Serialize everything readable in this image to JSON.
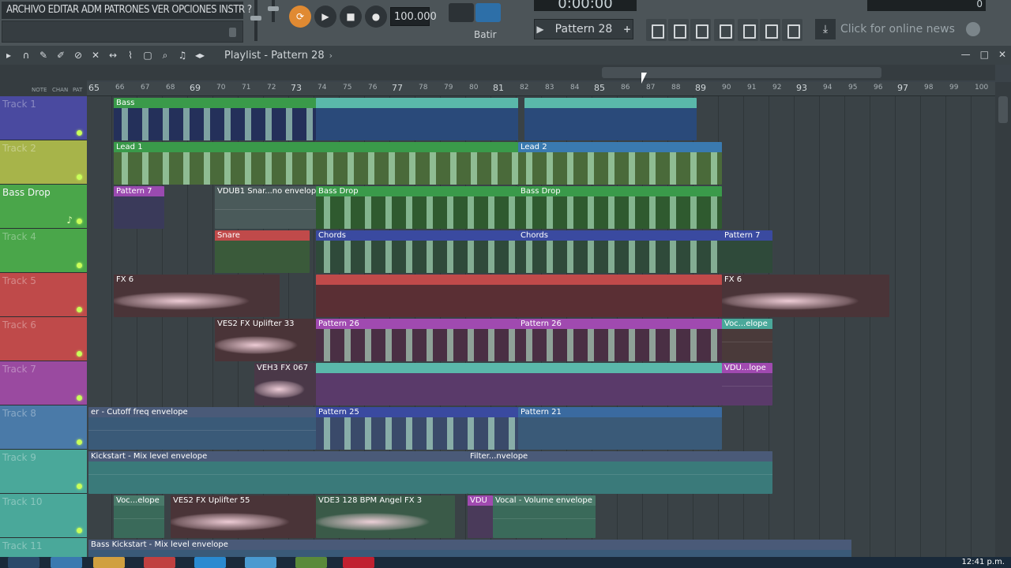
{
  "menu": {
    "text": "ARCHIVO EDITAR ADM PATRONES VER OPCIONES INSTR ?"
  },
  "transport": {
    "tempo": "100.000",
    "snap": "Batir",
    "position": "0:00:00",
    "peak": "0"
  },
  "pattern_selector": {
    "label": "Pattern 28",
    "prev": "▶",
    "add": "+"
  },
  "news": {
    "text": "Click for online news"
  },
  "playlist": {
    "title": "Playlist - Pattern 28",
    "ctl_labels": [
      "NOTE",
      "CHAN",
      "PAT"
    ]
  },
  "ruler": {
    "big": [
      {
        "label": "65"
      },
      {
        "label": "69"
      },
      {
        "label": "73"
      },
      {
        "label": "77"
      },
      {
        "label": "81"
      },
      {
        "label": "85"
      },
      {
        "label": "89"
      },
      {
        "label": "93"
      },
      {
        "label": "97"
      }
    ],
    "small": [
      {
        "label": "66"
      },
      {
        "label": "67"
      },
      {
        "label": "68"
      },
      {
        "label": "70"
      },
      {
        "label": "71"
      },
      {
        "label": "72"
      },
      {
        "label": "74"
      },
      {
        "label": "75"
      },
      {
        "label": "76"
      },
      {
        "label": "78"
      },
      {
        "label": "79"
      },
      {
        "label": "80"
      },
      {
        "label": "82"
      },
      {
        "label": "83"
      },
      {
        "label": "84"
      },
      {
        "label": "86"
      },
      {
        "label": "87"
      },
      {
        "label": "88"
      },
      {
        "label": "90"
      },
      {
        "label": "91"
      },
      {
        "label": "92"
      },
      {
        "label": "94"
      },
      {
        "label": "95"
      },
      {
        "label": "96"
      },
      {
        "label": "98"
      },
      {
        "label": "99"
      },
      {
        "label": "100"
      }
    ]
  },
  "tracks": [
    {
      "name": "Track 1",
      "color": "#4a4aa0",
      "named": false
    },
    {
      "name": "Track 2",
      "color": "#a7b44a",
      "named": false
    },
    {
      "name": "Bass Drop",
      "color": "#4aa64a",
      "named": true
    },
    {
      "name": "Track 4",
      "color": "#4aa64a",
      "named": false
    },
    {
      "name": "Track 5",
      "color": "#bf4a4a",
      "named": false
    },
    {
      "name": "Track 6",
      "color": "#bf4a4a",
      "named": false
    },
    {
      "name": "Track 7",
      "color": "#9a4aa0",
      "named": false
    },
    {
      "name": "Track 8",
      "color": "#4a7aa8",
      "named": false
    },
    {
      "name": "Track 9",
      "color": "#4aa89a",
      "named": false
    },
    {
      "name": "Track 10",
      "color": "#4aa89a",
      "named": false
    },
    {
      "name": "Track 11",
      "color": "#4aa89a",
      "named": false
    }
  ],
  "clips": [
    {
      "label": "Bass",
      "color": "#3a9a4a"
    },
    {
      "label": "Lead 1",
      "color": "#3a9a4a"
    },
    {
      "label": "Lead 2",
      "color": "#3a7ab0"
    },
    {
      "label": "Pattern 7",
      "color": "#9a4ab0"
    },
    {
      "label": "VDUB1 Snar...no envelope",
      "color": "#4a5a5a"
    },
    {
      "label": "Bass Drop",
      "color": "#3a9a4a"
    },
    {
      "label": "Bass Drop",
      "color": "#3a9a4a"
    },
    {
      "label": "Snare",
      "color": "#c04a4a"
    },
    {
      "label": "Chords",
      "color": "#3a4aa0"
    },
    {
      "label": "Chords",
      "color": "#3a4aa0"
    },
    {
      "label": "Pattern 7",
      "color": "#3a4aa0"
    },
    {
      "label": "FX 6",
      "color": "#4a3438"
    },
    {
      "label": "FX 6",
      "color": "#4a3438"
    },
    {
      "label": "VES2 FX Uplifter 33",
      "color": "#4a3438"
    },
    {
      "label": "Pattern 26",
      "color": "#a04ab0"
    },
    {
      "label": "Pattern 26",
      "color": "#a04ab0"
    },
    {
      "label": "Voc...elope",
      "color": "#4aa89a"
    },
    {
      "label": "VEH3 FX 067",
      "color": "#4a3848"
    },
    {
      "label": "VDU...lope",
      "color": "#a04ab0"
    },
    {
      "label": "er - Cutoff freq envelope",
      "color": "#4a5a78"
    },
    {
      "label": "Pattern 25",
      "color": "#3a4aa0"
    },
    {
      "label": "Pattern 21",
      "color": "#3a6aa0"
    },
    {
      "label": "Kickstart - Mix level envelope",
      "color": "#4a5a78"
    },
    {
      "label": "Filter...nvelope",
      "color": "#4a5a78"
    },
    {
      "label": "Voc...elope",
      "color": "#4a7a6a"
    },
    {
      "label": "VES2 FX Uplifter 55",
      "color": "#4a3438"
    },
    {
      "label": "VDE3 128 BPM Angel FX 3",
      "color": "#3a5a48"
    },
    {
      "label": "VDU",
      "color": "#a04ab0"
    },
    {
      "label": "Vocal - Volume envelope",
      "color": "#4a7a6a"
    },
    {
      "label": "Bass Kickstart - Mix level envelope",
      "color": "#4a5a78"
    }
  ],
  "clock": {
    "time": "12:41 p.m."
  }
}
